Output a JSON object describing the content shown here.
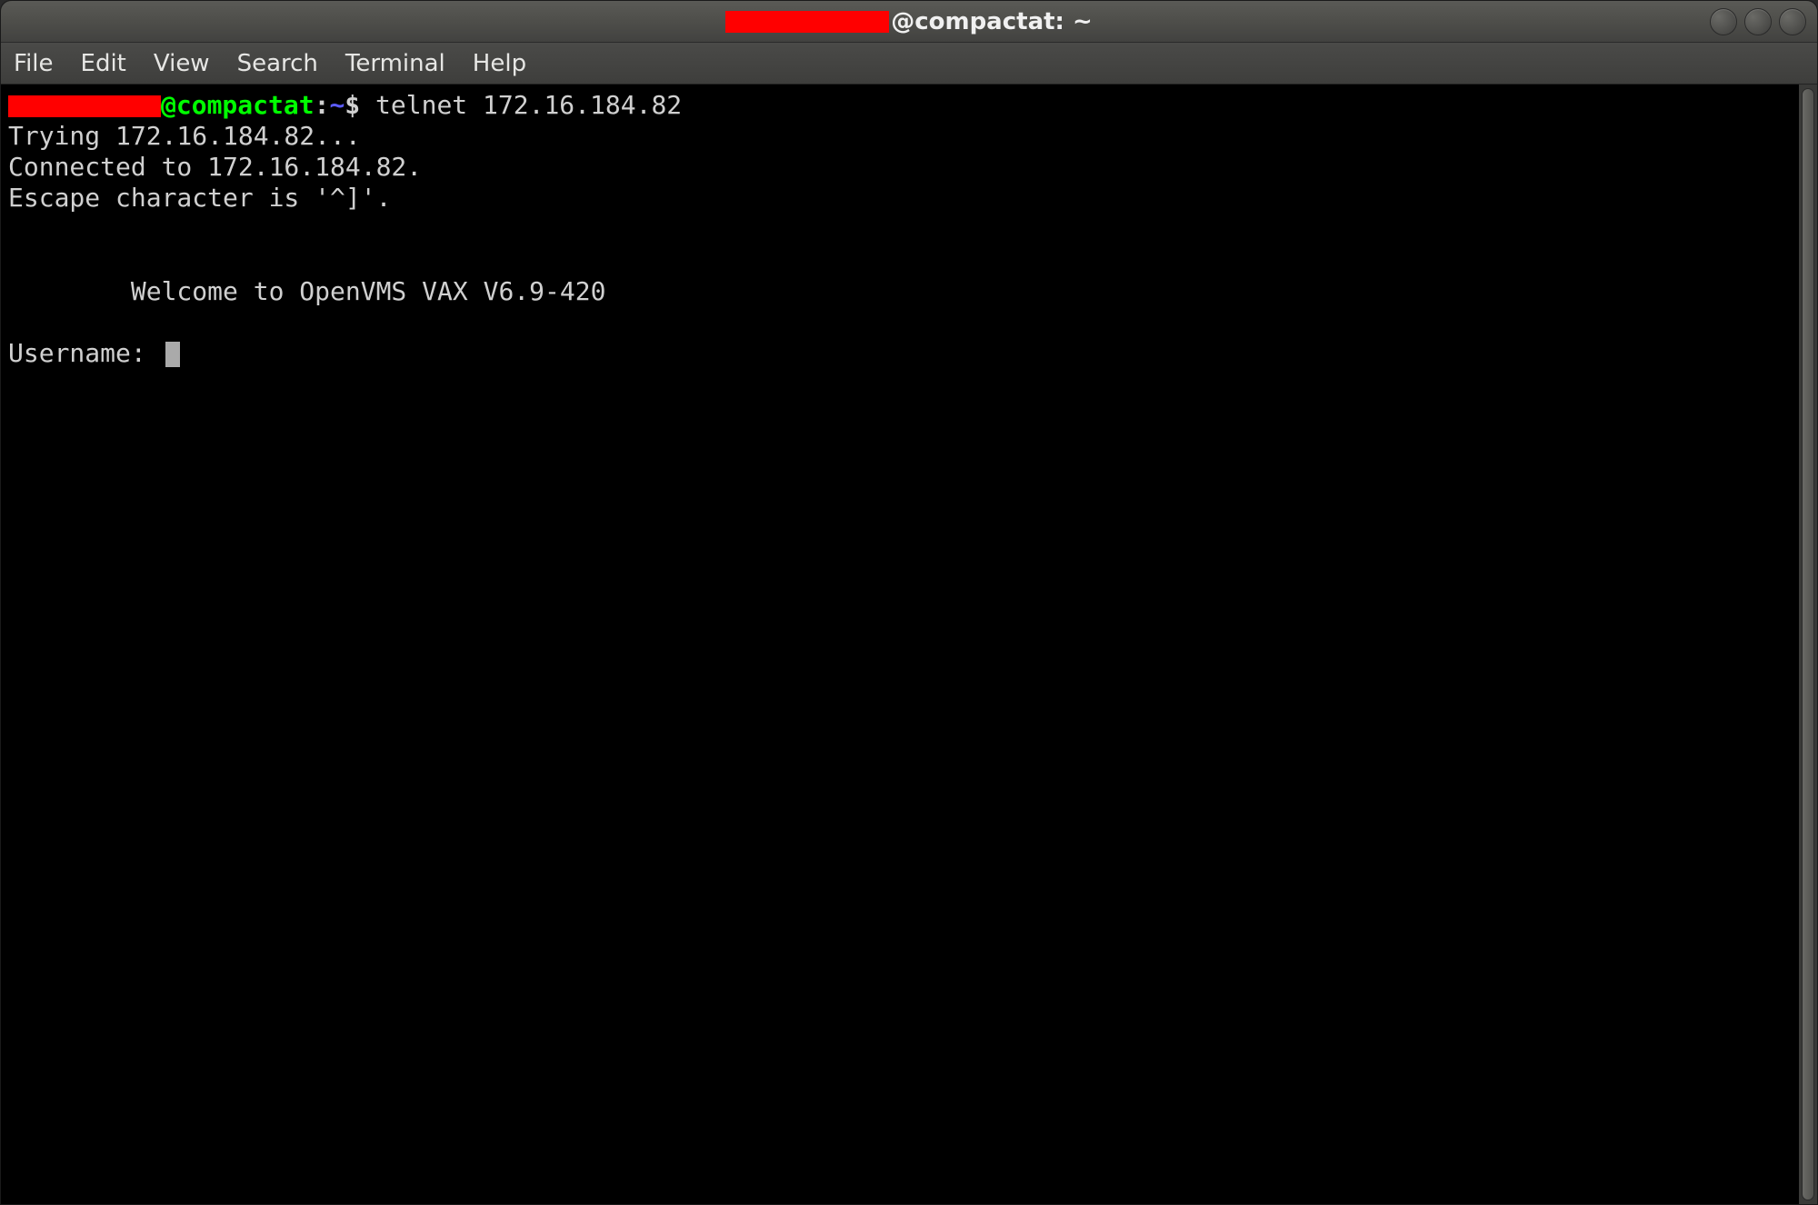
{
  "titlebar": {
    "redacted": true,
    "suffix": "@compactat: ~"
  },
  "menu": {
    "file": "File",
    "edit": "Edit",
    "view": "View",
    "search": "Search",
    "terminal": "Terminal",
    "help": "Help"
  },
  "terminal": {
    "prompt_host": "@compactat",
    "prompt_sep": ":",
    "prompt_path": "~",
    "prompt_dollar": "$",
    "command": " telnet 172.16.184.82",
    "line1": "Trying 172.16.184.82...",
    "line2": "Connected to 172.16.184.82.",
    "line3": "Escape character is '^]'.",
    "blank1": "",
    "blank2": "",
    "welcome": "        Welcome to OpenVMS VAX V6.9-420",
    "blank3": "",
    "username_prompt": "Username: "
  }
}
